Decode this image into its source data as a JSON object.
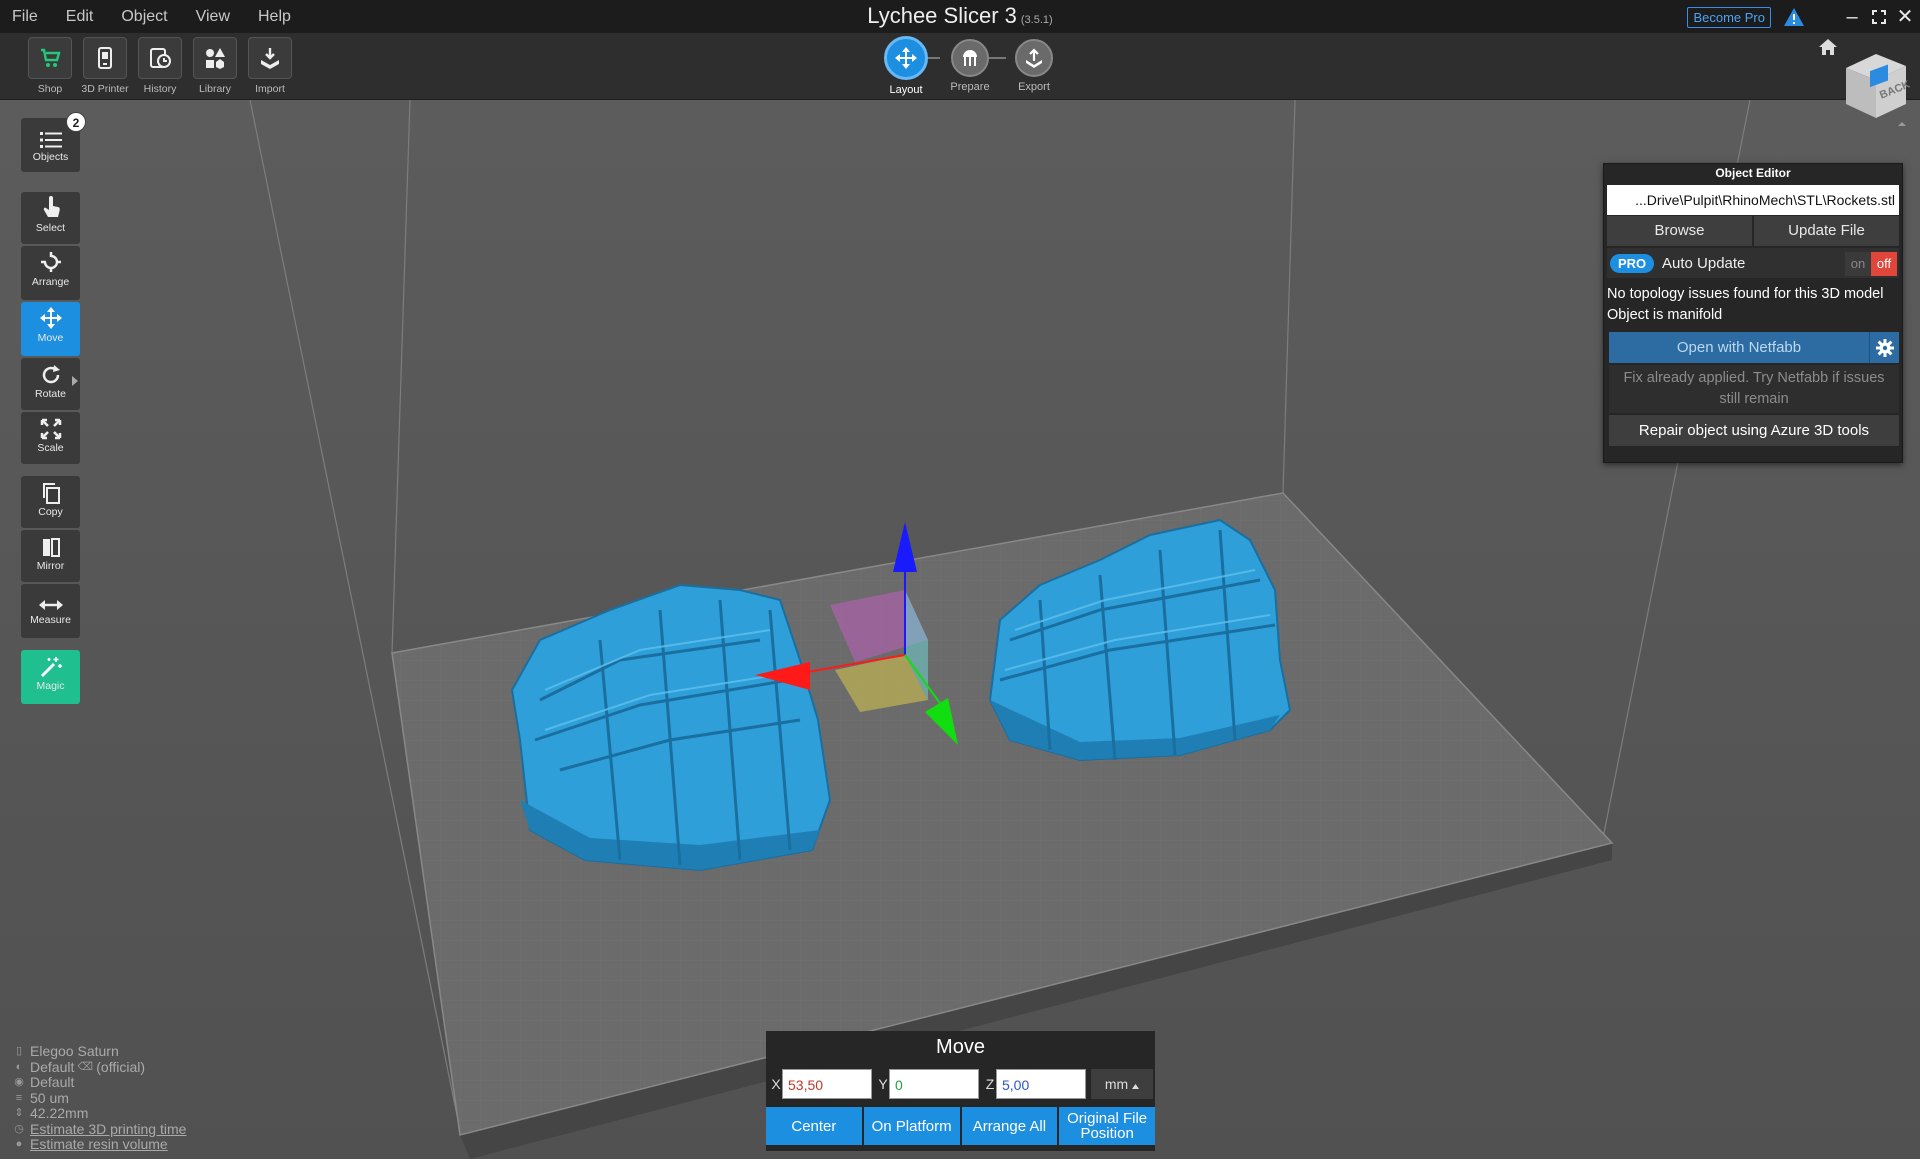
{
  "app": {
    "title": "Lychee Slicer 3",
    "version": "(3.5.1)"
  },
  "menu": [
    "File",
    "Edit",
    "Object",
    "View",
    "Help"
  ],
  "title_actions": {
    "become_pro": "Become Pro"
  },
  "toolbar": {
    "shop": "Shop",
    "printer": "3D Printer",
    "history": "History",
    "library": "Library",
    "import": "Import"
  },
  "steps": {
    "layout": "Layout",
    "prepare": "Prepare",
    "export": "Export",
    "active": "layout"
  },
  "view_cube": {
    "face_label": "BACK"
  },
  "sidebar": {
    "objects": "Objects",
    "objects_count": "2",
    "select": "Select",
    "arrange": "Arrange",
    "move": "Move",
    "rotate": "Rotate",
    "scale": "Scale",
    "copy": "Copy",
    "mirror": "Mirror",
    "measure": "Measure",
    "magic": "Magic"
  },
  "object_editor": {
    "title": "Object Editor",
    "file_path": "...Drive\\Pulpit\\RhinoMech\\STL\\Rockets.stl",
    "browse": "Browse",
    "update_file": "Update File",
    "pro_badge": "PRO",
    "auto_update": "Auto Update",
    "toggle_on": "on",
    "toggle_off": "off",
    "auto_update_state": "off",
    "topology_line1": "No topology issues found for this 3D model",
    "topology_line2": "Object is manifold",
    "open_netfabb": "Open with Netfabb",
    "fix_note": "Fix already applied. Try Netfabb if issues still remain",
    "repair_azure": "Repair object using Azure 3D tools"
  },
  "move_panel": {
    "title": "Move",
    "x_label": "X",
    "y_label": "Y",
    "z_label": "Z",
    "x_value": "53,50",
    "y_value": "0",
    "z_value": "5,00",
    "unit": "mm",
    "center": "Center",
    "on_platform": "On Platform",
    "arrange_all": "Arrange All",
    "original_position": "Original File Position",
    "colors": {
      "x": "#c0392b",
      "y": "#27a043",
      "z": "#2a56c6"
    }
  },
  "printer_info": {
    "printer": "Elegoo Saturn",
    "resin_profile": "Default",
    "resin_official": "(official)",
    "print_profile": "Default",
    "layer_height": "50 um",
    "height": "42.22mm",
    "estimate_time": "Estimate 3D printing time",
    "estimate_volume": "Estimate resin volume"
  },
  "colors": {
    "accent": "#1d8fe0",
    "model": "#2e9fd8",
    "magic": "#1fbf8f",
    "toggle_off": "#e0463a",
    "gizmo_x": "#ff1a1a",
    "gizmo_y": "#11dd11",
    "gizmo_z": "#1a1aff"
  }
}
